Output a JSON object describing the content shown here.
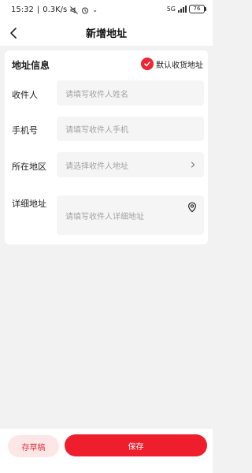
{
  "status_bar": {
    "time": "15:32",
    "network_speed": "0.3K/s",
    "network_type": "5G",
    "battery": "76",
    "icons": [
      "mute-icon",
      "alarm-icon",
      "signal-icon",
      "battery-icon"
    ]
  },
  "nav": {
    "title": "新增地址",
    "back_icon": "chevron-left-icon"
  },
  "form": {
    "section_title": "地址信息",
    "default_label": "默认收货地址",
    "default_checked": true,
    "fields": {
      "recipient": {
        "label": "收件人",
        "value": "",
        "placeholder": "请填写收件人姓名"
      },
      "phone": {
        "label": "手机号",
        "value": "",
        "placeholder": "请填写收件人手机"
      },
      "region": {
        "label": "所在地区",
        "value": "",
        "placeholder": "请选择收件人地址"
      },
      "detail": {
        "label": "详细地址",
        "value": "",
        "placeholder": "请填写收件人详细地址"
      }
    }
  },
  "actions": {
    "draft_label": "存草稿",
    "save_label": "保存"
  },
  "colors": {
    "accent": "#ee1e2c",
    "draft_bg": "#fde6e6",
    "page_bg": "#f2f2f2",
    "field_bg": "#f5f5f5"
  }
}
